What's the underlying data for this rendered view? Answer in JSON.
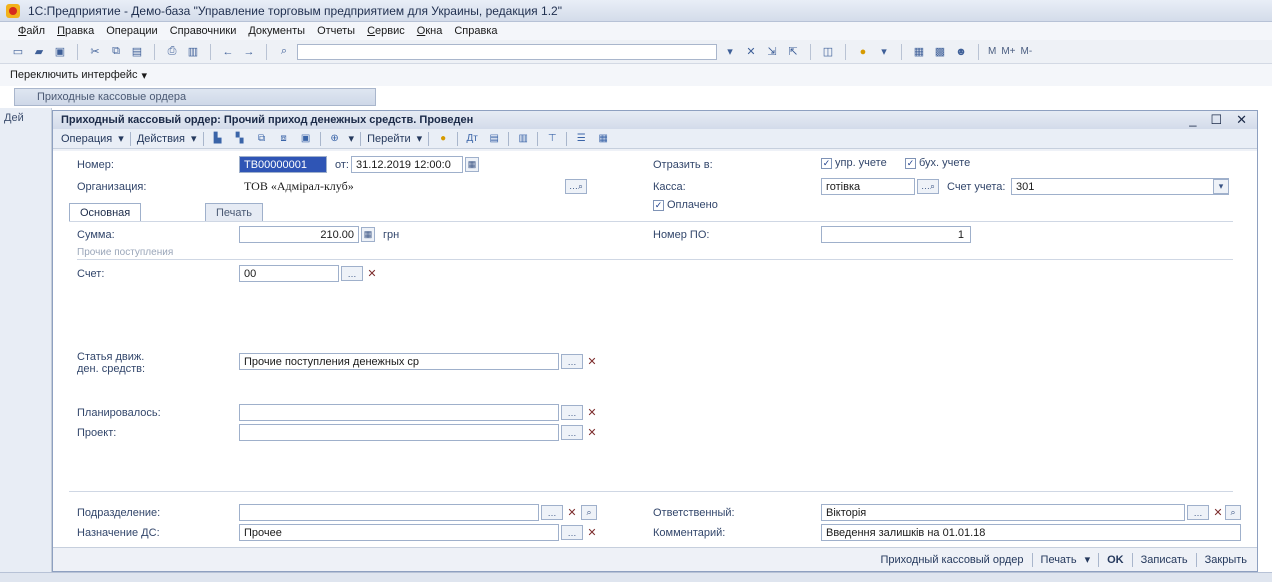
{
  "app": {
    "title": "1С:Предприятие - Демо-база \"Управление торговым предприятием для Украины, редакция 1.2\""
  },
  "menu": [
    "Файл",
    "Правка",
    "Операции",
    "Справочники",
    "Документы",
    "Отчеты",
    "Сервис",
    "Окна",
    "Справка"
  ],
  "toolbar": {
    "memory_labels": [
      "M",
      "M+",
      "M-"
    ]
  },
  "switch_interface": "Переключить интерфейс",
  "list_window": {
    "tab_title": "Приходные кассовые ордера",
    "side_caption": "Дей"
  },
  "dialog": {
    "title": "Приходный кассовый ордер: Прочий приход денежных средств. Проведен",
    "toolbar": {
      "operation": "Операция",
      "actions": "Действия",
      "goto": "Перейти"
    },
    "header": {
      "number_label": "Номер:",
      "number_value": "ТВ00000001",
      "date_label": "от:",
      "date_value": "31.12.2019 12:00:0",
      "reflect_label": "Отразить в:",
      "chk_mgmt": "упр. учете",
      "chk_acct": "бух. учете",
      "org_label": "Организация:",
      "org_value": "ТОВ «Адмірал-клуб»",
      "cash_label": "Касса:",
      "cash_value": "готівка",
      "account_label": "Счет учета:",
      "account_value": "301",
      "paid_label": "Оплачено"
    },
    "tabs": [
      "Основная",
      "Печать"
    ],
    "main": {
      "sum_label": "Сумма:",
      "sum_value": "210.00",
      "currency": "грн",
      "po_label": "Номер ПО:",
      "po_value": "1",
      "group_title": "Прочие поступления",
      "account_label": "Счет:",
      "account_value": "00",
      "cashflow_label_1": "Статья движ.",
      "cashflow_label_2": "ден. средств:",
      "cashflow_value": "Прочие поступления денежных ср",
      "planned_label": "Планировалось:",
      "planned_value": "",
      "project_label": "Проект:",
      "project_value": ""
    },
    "footer_fields": {
      "department_label": "Подразделение:",
      "department_value": "",
      "responsible_label": "Ответственный:",
      "responsible_value": "Вікторія",
      "purpose_label": "Назначение ДС:",
      "purpose_value": "Прочее",
      "comment_label": "Комментарий:",
      "comment_value": "Введення залишків на 01.01.18"
    },
    "status": {
      "doc_name": "Приходный кассовый ордер",
      "print": "Печать",
      "ok": "OK",
      "write": "Записать",
      "close": "Закрыть"
    }
  },
  "colors": {
    "accent": "#3e5f98",
    "selection": "#2f55b5"
  }
}
